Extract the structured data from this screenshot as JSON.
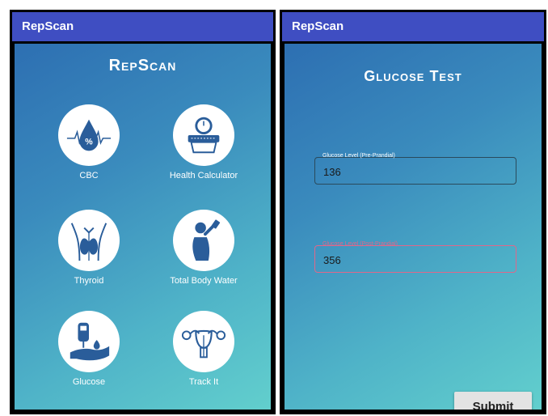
{
  "left": {
    "appbar_title": "RepScan",
    "heading": "RepScan",
    "tiles": [
      {
        "label": "CBC",
        "icon": "blood-drop-icon"
      },
      {
        "label": "Health Calculator",
        "icon": "scale-icon"
      },
      {
        "label": "Thyroid",
        "icon": "thyroid-icon"
      },
      {
        "label": "Total Body Water",
        "icon": "drinking-water-icon"
      },
      {
        "label": "Glucose",
        "icon": "glucose-meter-icon"
      },
      {
        "label": "Track It",
        "icon": "uterus-icon"
      }
    ]
  },
  "right": {
    "appbar_title": "RepScan",
    "heading": "Glucose Test",
    "fields": [
      {
        "label": "Glucose Level (Pre-Prandial)",
        "value": "136"
      },
      {
        "label": "Glucose Level (Post-Prandial)",
        "value": "356"
      }
    ],
    "submit_label": "Submit"
  },
  "colors": {
    "appbar": "#3f4ec2",
    "gradient_start": "#2d6fb2",
    "gradient_end": "#62cfcd",
    "focus_accent": "#e0678a"
  }
}
